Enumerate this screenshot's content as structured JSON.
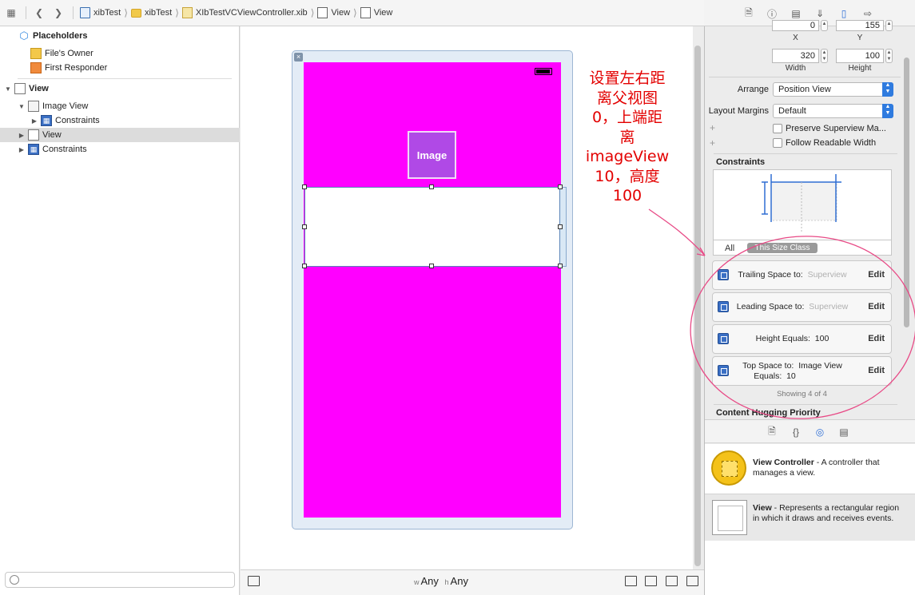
{
  "jumpbar": {
    "crumbs": [
      "xibTest",
      "xibTest",
      "XIbTestVCViewController.xib",
      "View",
      "View"
    ]
  },
  "outline": {
    "placeholders": "Placeholders",
    "files_owner": "File's Owner",
    "first_responder": "First Responder",
    "view": "View",
    "image_view": "Image View",
    "constraints_1": "Constraints",
    "child_view": "View",
    "constraints_2": "Constraints"
  },
  "canvas": {
    "image_label": "Image",
    "annotation": [
      "设置左右距",
      "离父视图",
      "0，上端距",
      "离",
      "imageView",
      "10，高度",
      "100"
    ],
    "size_class": {
      "w_prefix": "w",
      "w_value": "Any",
      "h_prefix": "h",
      "h_value": "Any"
    }
  },
  "inspector": {
    "x_value": "0",
    "y_value": "155",
    "x_label": "X",
    "y_label": "Y",
    "width_value": "320",
    "height_value": "100",
    "width_label": "Width",
    "height_label": "Height",
    "arrange_label": "Arrange",
    "arrange_value": "Position View",
    "layout_margins_label": "Layout Margins",
    "layout_margins_value": "Default",
    "preserve_superview": "Preserve Superview Ma...",
    "follow_readable": "Follow Readable Width",
    "constraints_header": "Constraints",
    "seg_all": "All",
    "seg_this": "This Size Class",
    "constraint_rows": [
      {
        "label": "Trailing Space to:",
        "value": "Superview",
        "edit": "Edit"
      },
      {
        "label": "Leading Space to:",
        "value": "Superview",
        "edit": "Edit"
      },
      {
        "label": "Height Equals:",
        "value": "100",
        "edit": "Edit"
      },
      {
        "label": "Top Space to:",
        "value": "Image View",
        "label2": "Equals:",
        "value2": "10",
        "edit": "Edit"
      }
    ],
    "showing": "Showing 4 of 4",
    "content_hugging": "Content Hugging Priority"
  },
  "library": {
    "items": [
      {
        "title": "View Controller",
        "desc": " - A controller that manages a view."
      },
      {
        "title": "View",
        "desc": " - Represents a rectangular region in which it draws and receives events."
      }
    ]
  },
  "colors": {
    "canvas_view": "#ff00ff",
    "image_view": "#b049e6",
    "annotation": "#e30000",
    "accent": "#2f7bdf"
  }
}
